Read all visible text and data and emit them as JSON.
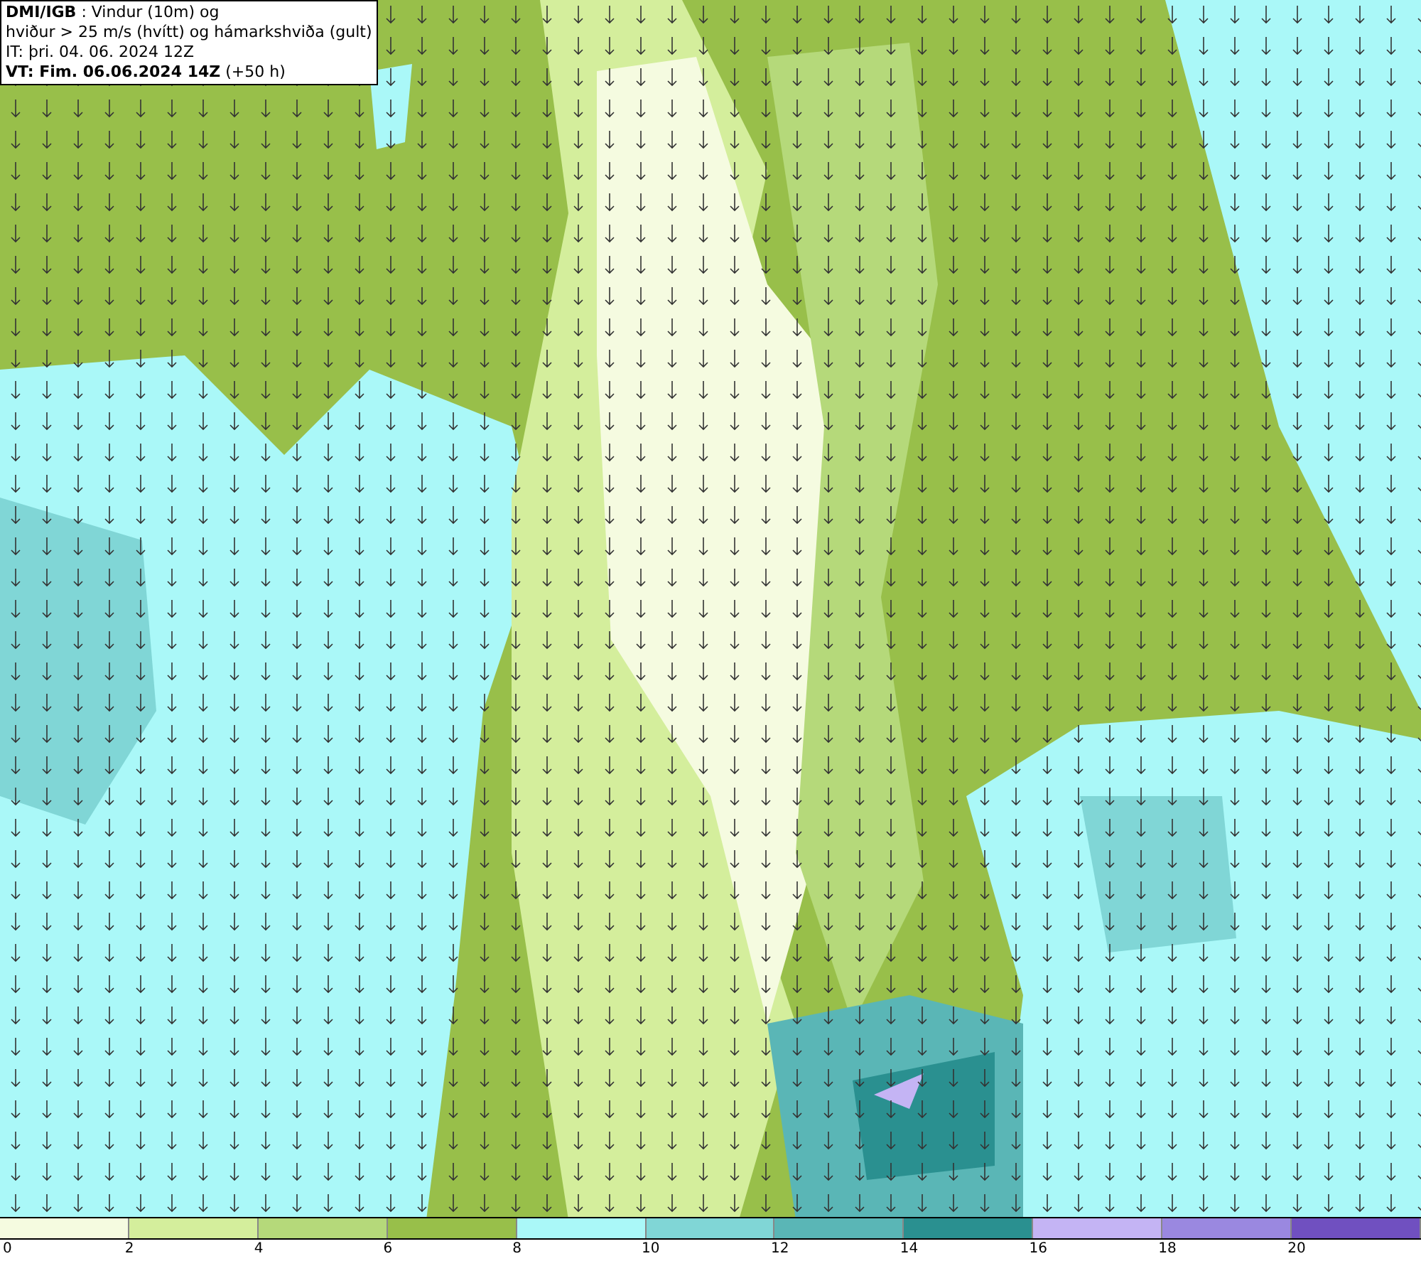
{
  "title_box": {
    "lines": [
      "**DMI/IGB** : Vindur (10m) og",
      "hviður > 25 m/s (hvítt) og hámarkshviða (gult)",
      "IT: þri. 04. 06. 2024 12Z",
      "**VT: Fim. 06.06.2024 14Z** (+50 h)"
    ]
  },
  "legend": [
    {
      "label": "0",
      "color": "#f5fbe0"
    },
    {
      "label": "2",
      "color": "#d4ee9c"
    },
    {
      "label": "4",
      "color": "#b5d97a"
    },
    {
      "label": "6",
      "color": "#98bf4a"
    },
    {
      "label": "8",
      "color": "#aaf8f8"
    },
    {
      "label": "10",
      "color": "#80d6d6"
    },
    {
      "label": "12",
      "color": "#5ab6b6"
    },
    {
      "label": "14",
      "color": "#2a9090"
    },
    {
      "label": "16",
      "color": "#c4b4f4"
    },
    {
      "label": "18",
      "color": "#9a88e0"
    },
    {
      "label": "20",
      "color": "#7050c0"
    }
  ]
}
